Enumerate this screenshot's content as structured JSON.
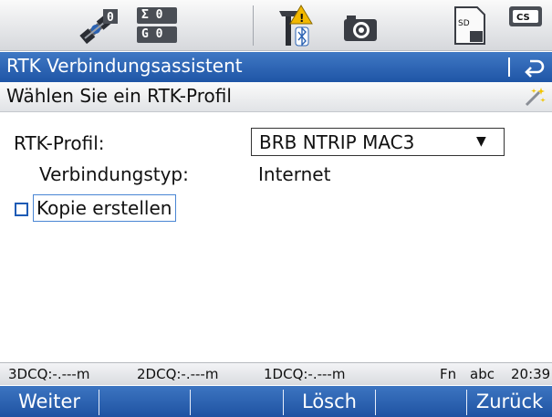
{
  "status_bar": {
    "satellite_count": "0",
    "sigma_count": "Σ 0",
    "gnss_count": "G 0",
    "sd_label": "SD",
    "cs_label": "CS"
  },
  "title_bar": {
    "title": "RTK Verbindungsassistent"
  },
  "sub_bar": {
    "subtitle": "Wählen Sie ein RTK-Profil"
  },
  "form": {
    "profile_label": "RTK-Profil:",
    "profile_value": "BRB NTRIP MAC3",
    "dropdown_arrow": "▼",
    "connection_type_label": "Verbindungstyp:",
    "connection_type_value": "Internet",
    "copy_label": "Kopie erstellen",
    "copy_checked": false
  },
  "info_bar": {
    "dcq3": "3DCQ:-.---m",
    "dcq2": "2DCQ:-.---m",
    "dcq1": "1DCQ:-.---m",
    "fn": "Fn",
    "input_mode": "abc",
    "time": "20:39"
  },
  "softkeys": {
    "f1": "Weiter",
    "f2": "",
    "f3": "",
    "f4": "Lösch",
    "f5": "",
    "f6": "Zurück"
  },
  "colors": {
    "accent_blue": "#2a62b3",
    "warning_yellow": "#f2b800",
    "status_gray": "#4a4e55"
  }
}
